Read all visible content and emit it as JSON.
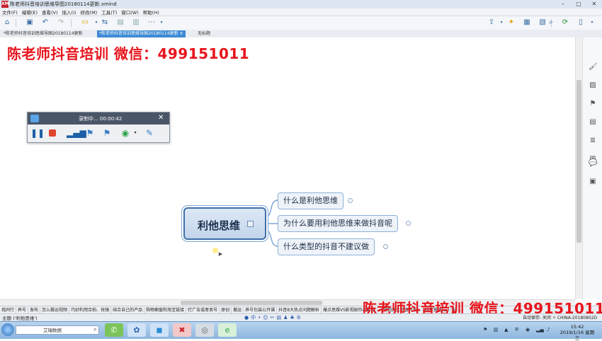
{
  "window": {
    "title": "陈老师抖音培训思维导图20180114更新.xmind",
    "app_logo": "XM"
  },
  "menu": [
    "文件(F)",
    "编辑(E)",
    "查看(V)",
    "插入(I)",
    "修改(M)",
    "工具(T)",
    "窗口(W)",
    "帮助(H)"
  ],
  "tabs": [
    {
      "label": "*陈老师抖音培训思维导图20180114更新",
      "active": false
    },
    {
      "label": "*陈老师抖音培训思维导图20180114更新",
      "active": true
    },
    {
      "label": "无标题",
      "active": false
    }
  ],
  "watermark": "陈老师抖音培训 微信：499151011",
  "recorder": {
    "status": "录制中... 00:00:42",
    "close": "✕"
  },
  "mindmap": {
    "central": "利他思维",
    "subtopics": [
      "什么是利他思维",
      "为什么要用利他思维来做抖音呢",
      "什么类型的抖音不建议做"
    ]
  },
  "bottom_tabs": [
    "找同行",
    "养号",
    "发布",
    "怎么搬运视频",
    "巧妙利用合拍、抢镜",
    "结合自己的产品",
    "购物橱窗和淘宝链接",
    "打广告或者卖号",
    "原创",
    "搬运",
    "养号包装公开课",
    "抖音8大热点问题解析",
    "爆点思维VS影视剧作品套路",
    "一镜到底大型宣传片...",
    "抖音营销(三)",
    "抖..."
  ],
  "status": {
    "left": "主题 ('利他思维')",
    "right": "自动保存: 关闭   ⚪ CHINA-20180802D"
  },
  "taskbar": {
    "search_text": "艾瑞数据",
    "time": "15:42",
    "date": "2019/1/16 星期三"
  },
  "colors": {
    "accent": "#3d8ad4",
    "watermark": "#e8141c",
    "topic_border": "#3f6fa8"
  }
}
